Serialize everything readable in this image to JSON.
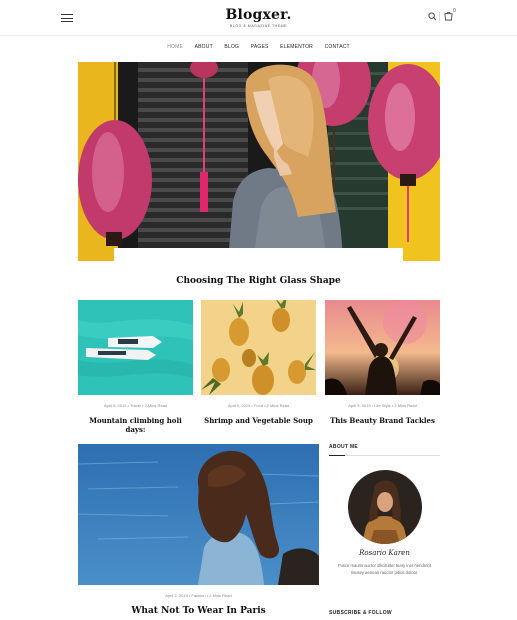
{
  "header": {
    "logo": "Blogxer.",
    "tagline": "BLOG & MAGAZINE THEME",
    "cart_count": "0"
  },
  "nav": {
    "items": [
      "HOME",
      "ABOUT",
      "BLOG",
      "PAGES",
      "ELEMENTOR",
      "CONTACT"
    ],
    "active": "HOME"
  },
  "hero": {
    "title": "Choosing The Right Glass Shape"
  },
  "cards": [
    {
      "meta": "April 5, 2019  •  Travel  •  2 Mins Read",
      "title": "Mountain climbing holi days:"
    },
    {
      "meta": "April 5, 2019  •  Food  •  2 Mins Read",
      "title": "Shrimp and Vegetable Soup"
    },
    {
      "meta": "April 5, 2019  •  Life Style  •  2 Mins Read",
      "title": "This Beauty Brand Tackles"
    }
  ],
  "featured": {
    "meta": "April 2, 2019  •  Fashion  •  2 Mins Read",
    "title": "What Not To Wear In Paris"
  },
  "sidebar": {
    "about_heading": "ABOUT ME",
    "signature": "Rosario Karen",
    "about_text": "Fusce mauris auctor ollicituder teary iner hendrerit risusey aenean rauctor pibus doloor.",
    "subscribe_heading": "SUBSCRIBE & FOLLOW"
  },
  "colors": {
    "accent": "#111111",
    "muted": "#888888"
  }
}
